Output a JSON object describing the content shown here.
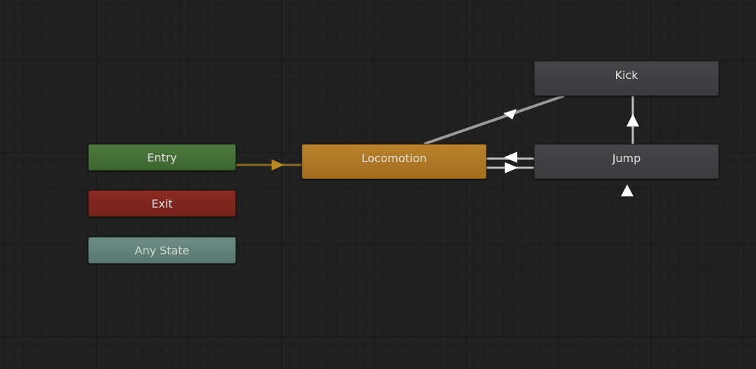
{
  "graph": {
    "nodes": {
      "entry": {
        "label": "Entry",
        "color": "#416a33"
      },
      "exit": {
        "label": "Exit",
        "color": "#7c241d"
      },
      "any_state": {
        "label": "Any State",
        "color": "#5f7e76"
      },
      "locomotion": {
        "label": "Locomotion",
        "color": "#ab7424",
        "default": true
      },
      "jump": {
        "label": "Jump",
        "color": "#404042"
      },
      "kick": {
        "label": "Kick",
        "color": "#404042"
      }
    },
    "transitions": [
      {
        "from": "Entry",
        "to": "Locomotion",
        "color": "#8a6a20"
      },
      {
        "from": "Locomotion",
        "to": "Jump",
        "color": "#bdbdbd"
      },
      {
        "from": "Jump",
        "to": "Locomotion",
        "color": "#bdbdbd"
      },
      {
        "from": "Jump",
        "to": "Kick",
        "color": "#bdbdbd"
      },
      {
        "from": "Kick",
        "to": "Locomotion",
        "color": "#bdbdbd"
      }
    ]
  }
}
